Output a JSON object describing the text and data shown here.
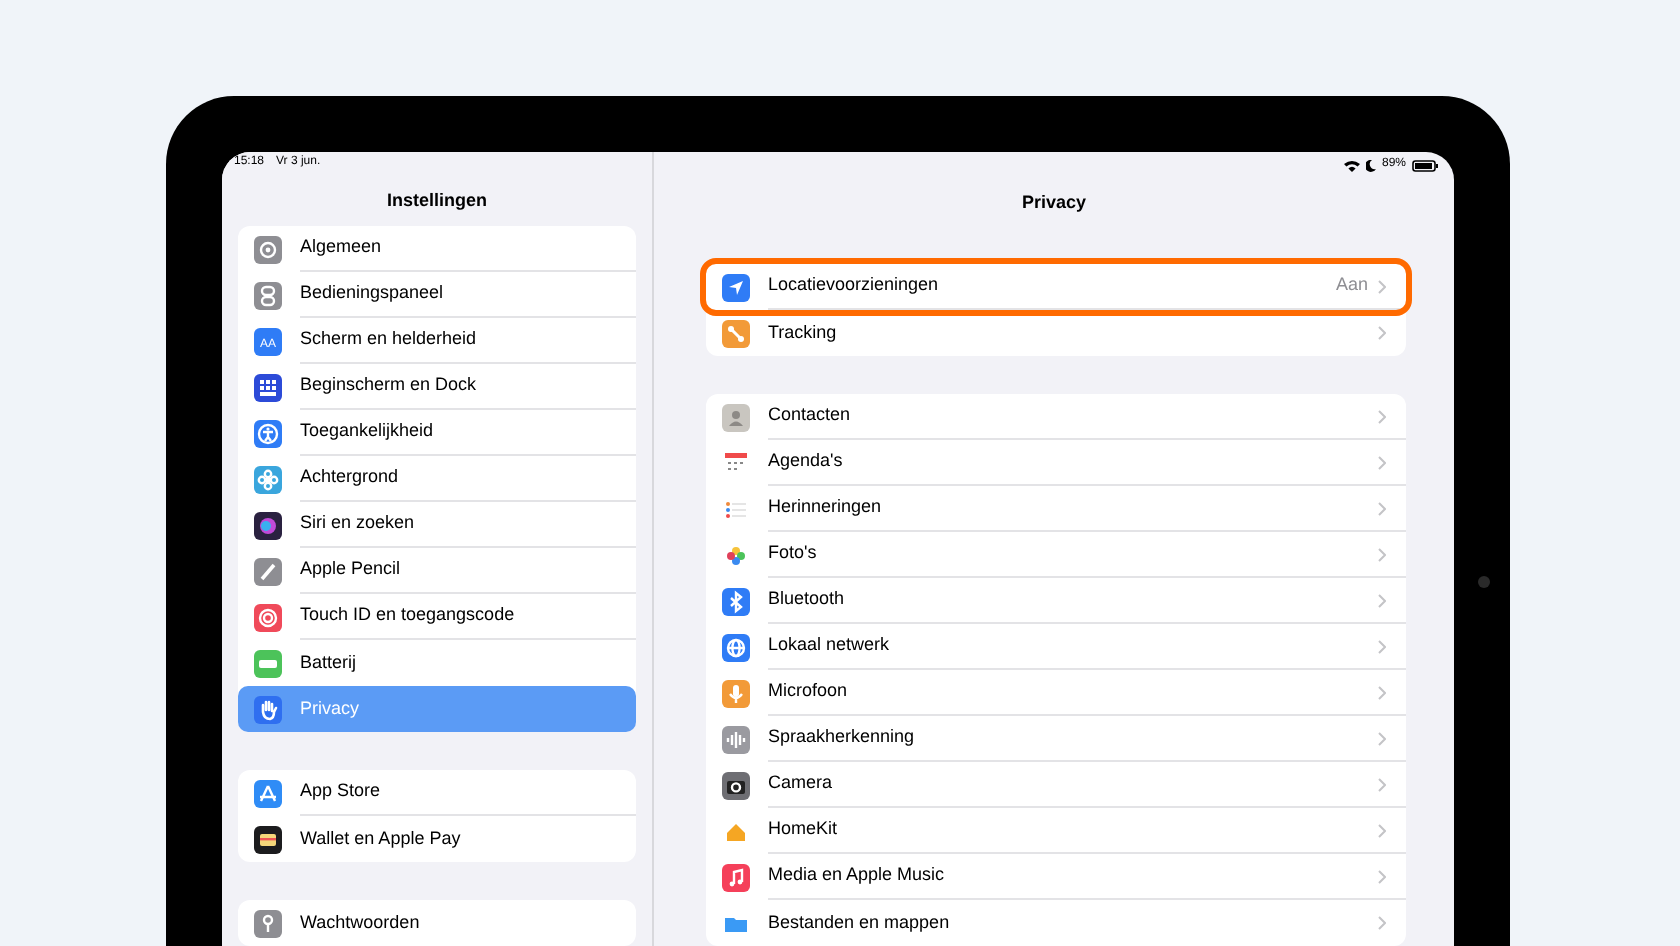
{
  "status_bar": {
    "time": "15:18",
    "date": "Vr 3 jun.",
    "battery": "89%"
  },
  "sidebar": {
    "title": "Instellingen",
    "groups": [
      {
        "items": [
          {
            "label": "Algemeen",
            "color": "#8e8e93",
            "selected": false
          },
          {
            "label": "Bedieningspaneel",
            "color": "#8e8e93",
            "selected": false
          },
          {
            "label": "Scherm en helderheid",
            "icon_text": "AA",
            "color": "#2f7cf6",
            "selected": false
          },
          {
            "label": "Beginscherm en Dock",
            "color": "#2c4bd8",
            "selected": false
          },
          {
            "label": "Toegankelijkheid",
            "color": "#2f7cf6",
            "selected": false
          },
          {
            "label": "Achtergrond",
            "color": "#3aa6dd",
            "selected": false
          },
          {
            "label": "Siri en zoeken",
            "color": "#2a2140",
            "selected": false
          },
          {
            "label": "Apple Pencil",
            "color": "#8e8e93",
            "selected": false
          },
          {
            "label": "Touch ID en toegangscode",
            "color": "#f04a5a",
            "selected": false
          },
          {
            "label": "Batterij",
            "color": "#4cc35a",
            "selected": false
          },
          {
            "label": "Privacy",
            "color": "#2f6ff0",
            "selected": true
          }
        ]
      },
      {
        "items": [
          {
            "label": "App Store",
            "color": "#2f8cf6",
            "selected": false
          },
          {
            "label": "Wallet en Apple Pay",
            "color": "#1c1c1e",
            "selected": false
          }
        ]
      },
      {
        "items": [
          {
            "label": "Wachtwoorden",
            "color": "#8e8e93",
            "selected": false
          }
        ]
      }
    ]
  },
  "detail": {
    "title": "Privacy",
    "groups": [
      {
        "items": [
          {
            "label": "Locatievoorzieningen",
            "value": "Aan",
            "color": "#2f7cf6",
            "highlighted": true
          },
          {
            "label": "Tracking",
            "color": "#f29a38",
            "highlighted": false
          }
        ]
      },
      {
        "items": [
          {
            "label": "Contacten",
            "color": "#c9c6c0",
            "highlighted": false
          },
          {
            "label": "Agenda's",
            "color": "#ffffff",
            "highlighted": false
          },
          {
            "label": "Herinneringen",
            "color": "#ffffff",
            "highlighted": false
          },
          {
            "label": "Foto's",
            "color": "#ffffff",
            "highlighted": false
          },
          {
            "label": "Bluetooth",
            "color": "#2f7cf6",
            "highlighted": false
          },
          {
            "label": "Lokaal netwerk",
            "color": "#2f7cf6",
            "highlighted": false
          },
          {
            "label": "Microfoon",
            "color": "#f29a38",
            "highlighted": false
          },
          {
            "label": "Spraakherkenning",
            "color": "#9a9aa0",
            "highlighted": false
          },
          {
            "label": "Camera",
            "color": "#6e6e73",
            "highlighted": false
          },
          {
            "label": "HomeKit",
            "color": "#ffffff",
            "highlighted": false
          },
          {
            "label": "Media en Apple Music",
            "color": "#f5405a",
            "highlighted": false
          },
          {
            "label": "Bestanden en mappen",
            "color": "#ffffff",
            "highlighted": false
          }
        ]
      }
    ]
  }
}
